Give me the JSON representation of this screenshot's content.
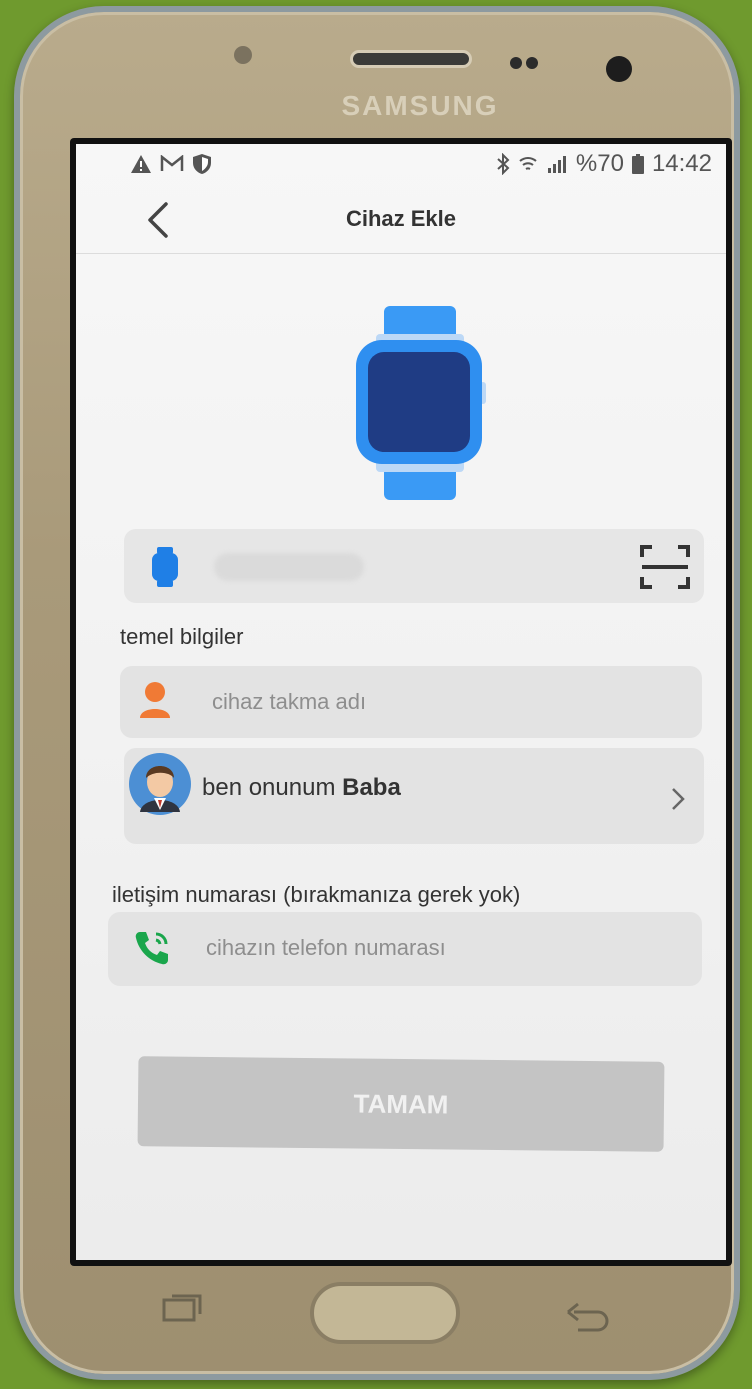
{
  "device_brand": "SAMSUNG",
  "statusbar": {
    "battery_pct": "%70",
    "time": "14:42",
    "left_icons": [
      "warning-icon",
      "gmail-icon",
      "shield-icon"
    ],
    "right_icons": [
      "bluetooth-icon",
      "wifi-icon",
      "signal-icon",
      "battery-icon"
    ]
  },
  "header": {
    "title": "Cihaz Ekle"
  },
  "basic_info": {
    "section_label": "temel bilgiler",
    "nickname_placeholder": "cihaz takma adı",
    "relation_prefix": "ben onunum",
    "relation_value": "Baba"
  },
  "contact": {
    "section_label": "iletişim numarası (bırakmanıza gerek yok)",
    "phone_placeholder": "cihazın telefon numarası"
  },
  "actions": {
    "confirm_label": "TAMAM"
  },
  "colors": {
    "watch_blue": "#2f8ff0",
    "watch_screen": "#1f3c84",
    "phone_icon_green": "#1aa64c",
    "person_icon_orange": "#f07a35",
    "button_disabled": "#c4c4c4"
  }
}
